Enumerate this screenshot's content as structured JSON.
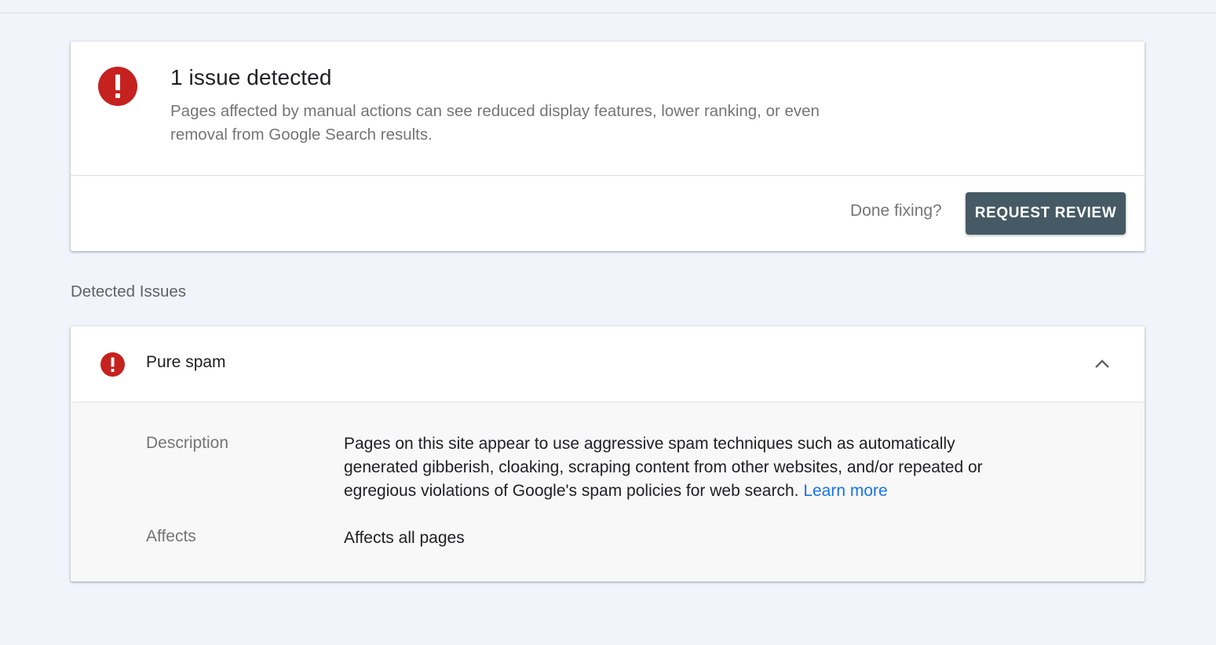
{
  "summary": {
    "title": "1 issue detected",
    "description": "Pages affected by manual actions can see reduced display features, lower ranking, or even removal from Google Search results.",
    "done_fixing_text": "Done fixing?",
    "request_review_label": "REQUEST REVIEW"
  },
  "detected_issues": {
    "heading": "Detected Issues",
    "issues": [
      {
        "title": "Pure spam",
        "description_label": "Description",
        "description_text": "Pages on this site appear to use aggressive spam techniques such as automatically generated gibberish, cloaking, scraping content from other websites, and/or repeated or egregious violations of Google's spam policies for web search.",
        "learn_more_label": "Learn more",
        "affects_label": "Affects",
        "affects_value": "Affects all pages"
      }
    ]
  },
  "icons": {
    "error": "error-icon",
    "collapse": "chevron-up-icon"
  },
  "colors": {
    "background": "#f1f4fb",
    "error_red": "#c5221f",
    "button_background": "#455a64",
    "link_blue": "#1a73e8"
  }
}
